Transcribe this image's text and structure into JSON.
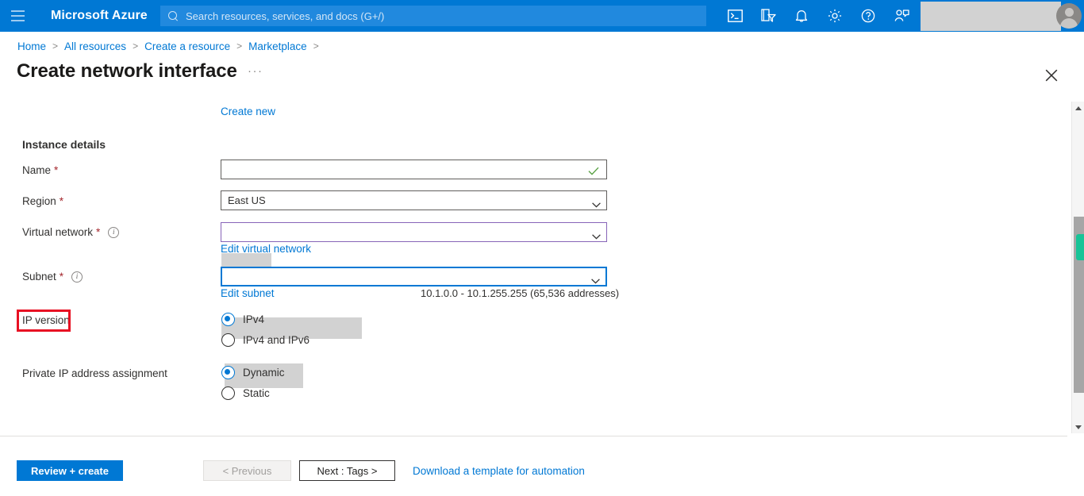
{
  "header": {
    "menu_icon": "hamburger-icon",
    "brand": "Microsoft Azure",
    "search_placeholder": "Search resources, services, and docs (G+/)",
    "icons": [
      {
        "name": "cloud-shell-icon",
        "title": "Cloud Shell"
      },
      {
        "name": "directory-filter-icon",
        "title": "Directories + subscriptions"
      },
      {
        "name": "notifications-bell-icon",
        "title": "Notifications"
      },
      {
        "name": "settings-gear-icon",
        "title": "Settings"
      },
      {
        "name": "help-question-icon",
        "title": "Help"
      },
      {
        "name": "feedback-person-icon",
        "title": "Feedback"
      }
    ],
    "account_redacted": true
  },
  "breadcrumb": {
    "items": [
      "Home",
      "All resources",
      "Create a resource",
      "Marketplace"
    ],
    "separator": ">"
  },
  "page": {
    "title": "Create network interface",
    "more_label": "···",
    "close_label": "Close"
  },
  "form": {
    "create_new_link": "Create new",
    "section_title": "Instance details",
    "fields": {
      "name": {
        "label": "Name",
        "required": "*",
        "value": "",
        "redacted": true,
        "validation": "valid"
      },
      "region": {
        "label": "Region",
        "required": "*",
        "value": "East US"
      },
      "virtual_network": {
        "label": "Virtual network",
        "required": "*",
        "has_info": true,
        "value": "",
        "redacted": true,
        "edit_link": "Edit virtual network"
      },
      "subnet": {
        "label": "Subnet",
        "required": "*",
        "has_info": true,
        "value": "",
        "redacted": true,
        "edit_link": "Edit subnet",
        "address_range": "10.1.0.0 - 10.1.255.255 (65,536 addresses)"
      },
      "ip_version": {
        "label": "IP version",
        "highlighted": true,
        "options": [
          {
            "label": "IPv4",
            "selected": true
          },
          {
            "label": "IPv4 and IPv6",
            "selected": false
          }
        ]
      },
      "private_ip_assignment": {
        "label": "Private IP address assignment",
        "options": [
          {
            "label": "Dynamic",
            "selected": true
          },
          {
            "label": "Static",
            "selected": false
          }
        ]
      }
    }
  },
  "footer": {
    "review_create": "Review + create",
    "previous": "< Previous",
    "next": "Next : Tags >",
    "download_template": "Download a template for automation"
  },
  "colors": {
    "azure_blue": "#0078d4",
    "annotation_red": "#e81123",
    "validation_green": "#5aa245",
    "vnet_border_purple": "#8764b8",
    "scroll_marker_green": "#17c497",
    "required_red": "#a4262c"
  }
}
